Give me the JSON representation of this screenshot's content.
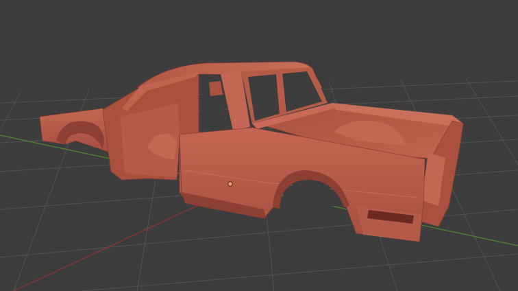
{
  "viewport": {
    "background": "#3d3d3d",
    "grid_color": "#525252",
    "x_axis_color": "#8a3434",
    "y_axis_color": "#4e8a2a"
  },
  "model": {
    "body_color": "#b85a49",
    "shadow_color": "#8e3f33",
    "highlight_color": "#c96a58",
    "dark_color": "#6a2a22"
  },
  "origin_marker": {
    "color": "#e8a060",
    "icon": "origin-dot-icon"
  }
}
